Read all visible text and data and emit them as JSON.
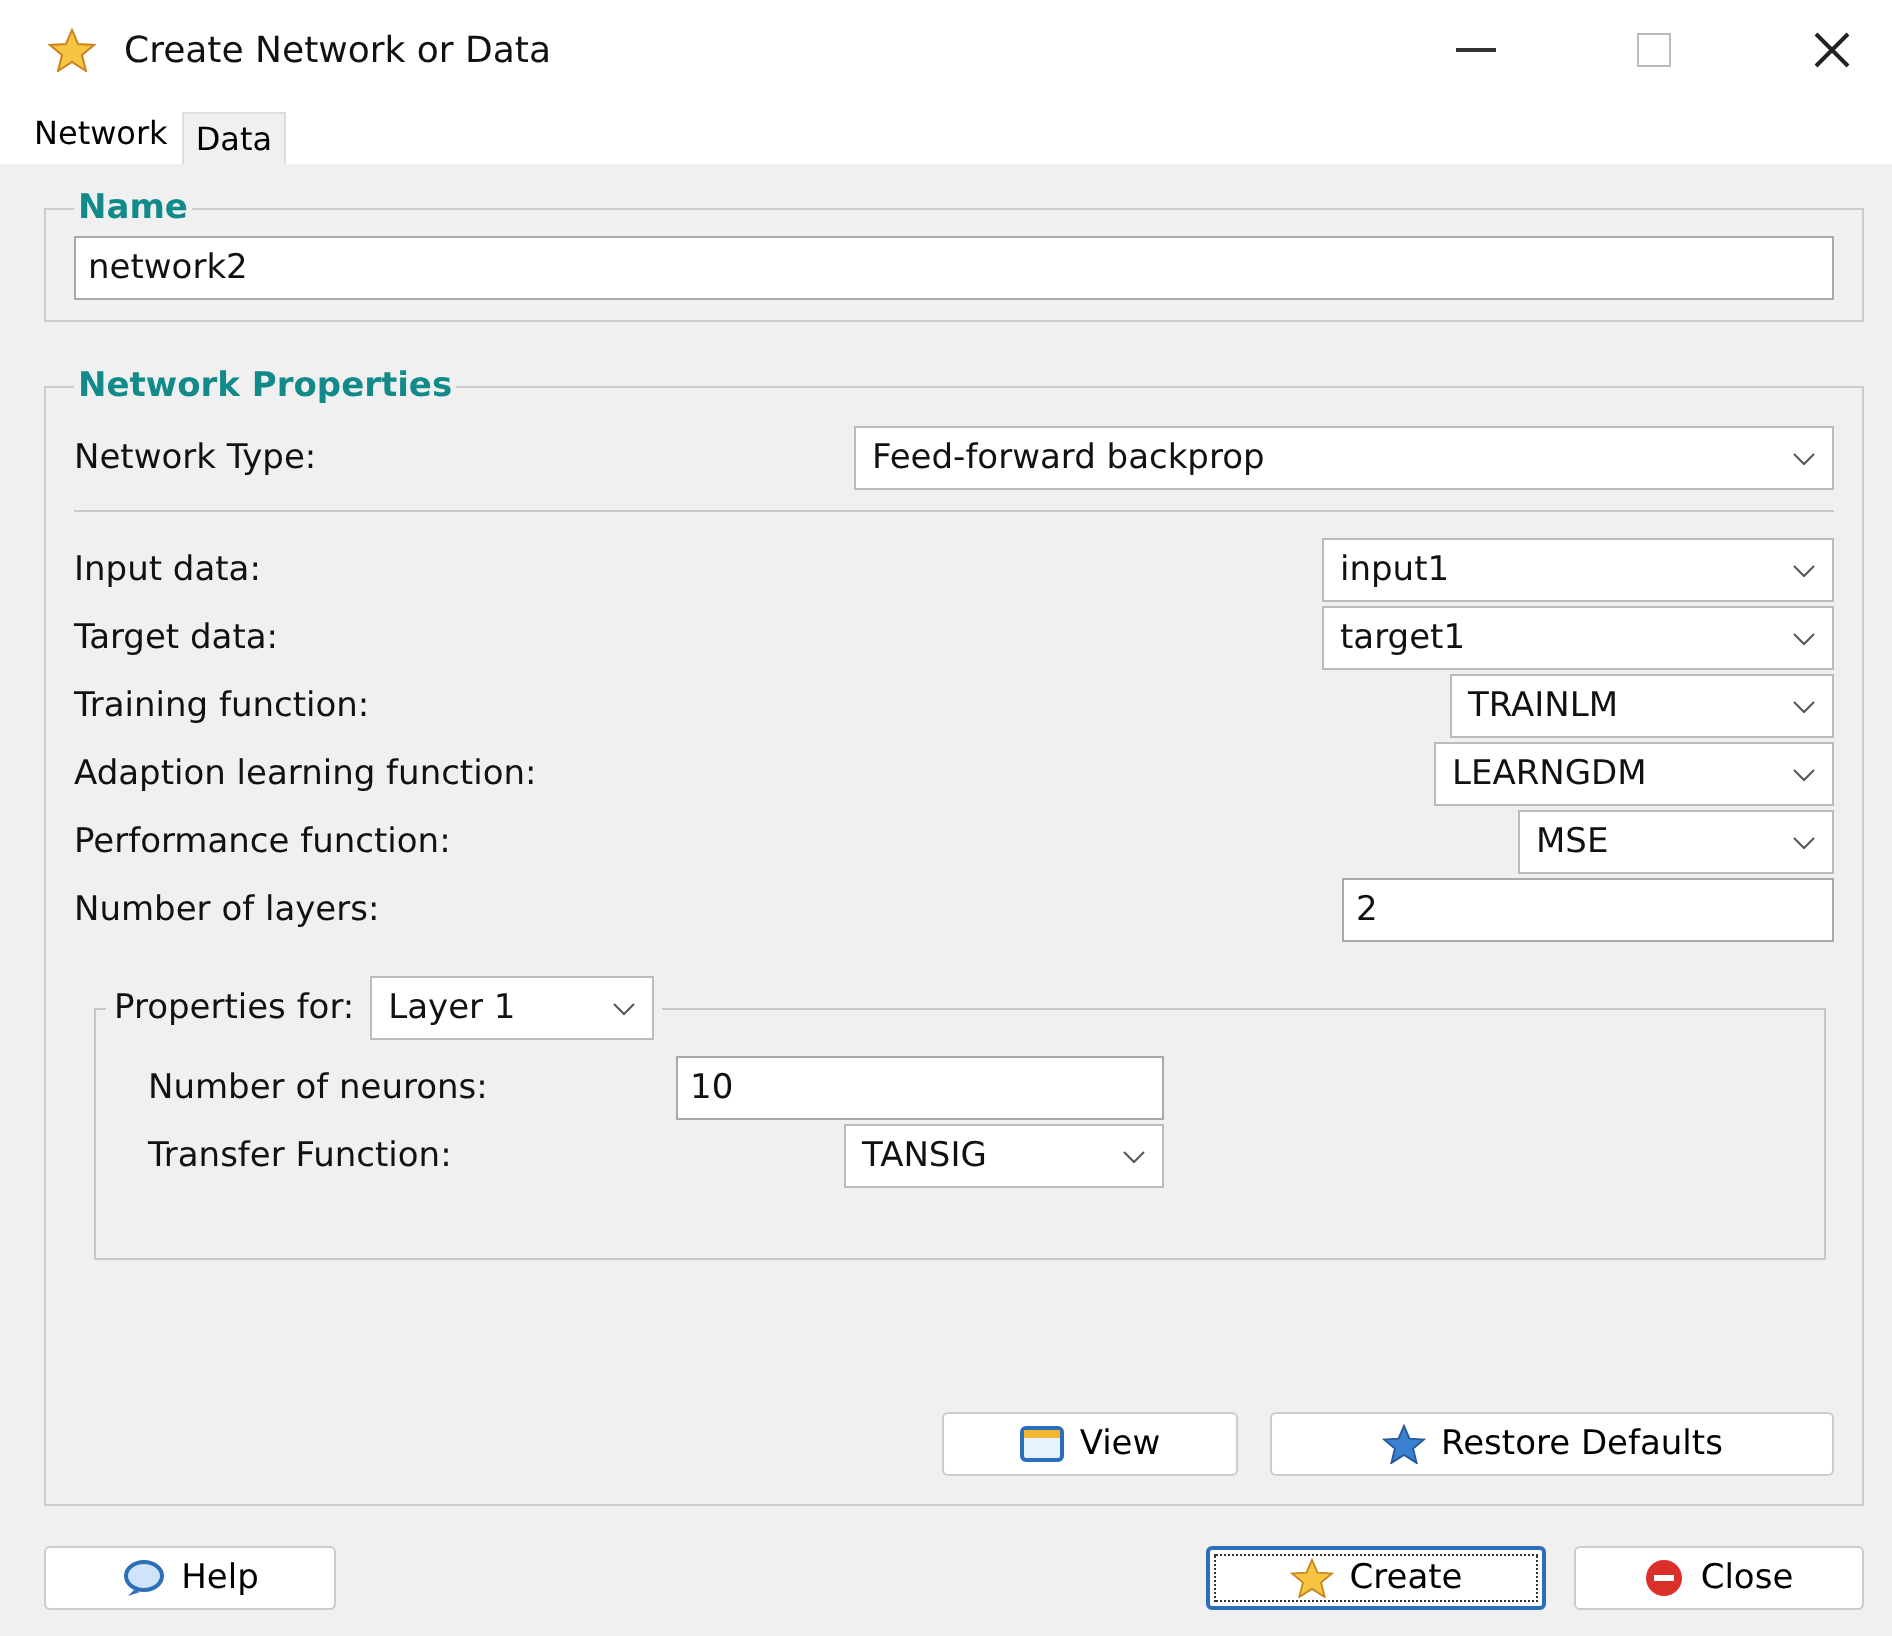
{
  "window": {
    "title": "Create Network or Data"
  },
  "tabs": [
    {
      "label": "Network",
      "selected": true
    },
    {
      "label": "Data",
      "selected": false
    }
  ],
  "name_group": {
    "title": "Name",
    "value": "network2"
  },
  "properties": {
    "title": "Network Properties",
    "network_type": {
      "label": "Network Type:",
      "value": "Feed-forward backprop"
    },
    "rows": [
      {
        "kind": "combo",
        "label": "Input data:",
        "value": "input1"
      },
      {
        "kind": "combo",
        "label": "Target data:",
        "value": "target1"
      },
      {
        "kind": "combo",
        "label": "Training function:",
        "value": "TRAINLM"
      },
      {
        "kind": "combo",
        "label": "Adaption learning function:",
        "value": "LEARNGDM"
      },
      {
        "kind": "combo",
        "label": "Performance function:",
        "value": "MSE"
      },
      {
        "kind": "field",
        "label": "Number of layers:",
        "value": "2"
      }
    ],
    "layer_group": {
      "label": "Properties for:",
      "layer": "Layer 1",
      "rows": [
        {
          "kind": "field",
          "label": "Number of neurons:",
          "value": "10"
        },
        {
          "kind": "combo",
          "label": "Transfer Function:",
          "value": "TANSIG"
        }
      ]
    },
    "buttons": [
      {
        "kind": "view",
        "label": "View"
      },
      {
        "kind": "restore",
        "label": "Restore Defaults"
      }
    ]
  },
  "footer_buttons": [
    {
      "kind": "help",
      "label": "Help",
      "focused": false
    },
    {
      "kind": "create",
      "label": "Create",
      "focused": true
    },
    {
      "kind": "close",
      "label": "Close",
      "focused": false
    }
  ]
}
